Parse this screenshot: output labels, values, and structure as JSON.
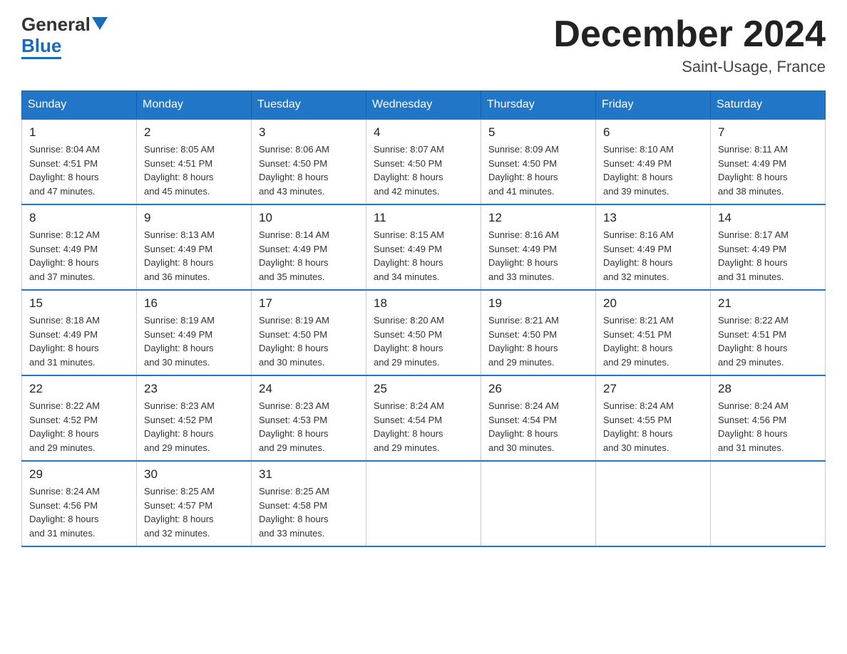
{
  "logo": {
    "text_general": "General",
    "text_blue": "Blue",
    "arrow_alt": "arrow"
  },
  "header": {
    "month_title": "December 2024",
    "location": "Saint-Usage, France"
  },
  "weekdays": [
    "Sunday",
    "Monday",
    "Tuesday",
    "Wednesday",
    "Thursday",
    "Friday",
    "Saturday"
  ],
  "weeks": [
    [
      {
        "day": "1",
        "sunrise": "8:04 AM",
        "sunset": "4:51 PM",
        "daylight": "8 hours and 47 minutes."
      },
      {
        "day": "2",
        "sunrise": "8:05 AM",
        "sunset": "4:51 PM",
        "daylight": "8 hours and 45 minutes."
      },
      {
        "day": "3",
        "sunrise": "8:06 AM",
        "sunset": "4:50 PM",
        "daylight": "8 hours and 43 minutes."
      },
      {
        "day": "4",
        "sunrise": "8:07 AM",
        "sunset": "4:50 PM",
        "daylight": "8 hours and 42 minutes."
      },
      {
        "day": "5",
        "sunrise": "8:09 AM",
        "sunset": "4:50 PM",
        "daylight": "8 hours and 41 minutes."
      },
      {
        "day": "6",
        "sunrise": "8:10 AM",
        "sunset": "4:49 PM",
        "daylight": "8 hours and 39 minutes."
      },
      {
        "day": "7",
        "sunrise": "8:11 AM",
        "sunset": "4:49 PM",
        "daylight": "8 hours and 38 minutes."
      }
    ],
    [
      {
        "day": "8",
        "sunrise": "8:12 AM",
        "sunset": "4:49 PM",
        "daylight": "8 hours and 37 minutes."
      },
      {
        "day": "9",
        "sunrise": "8:13 AM",
        "sunset": "4:49 PM",
        "daylight": "8 hours and 36 minutes."
      },
      {
        "day": "10",
        "sunrise": "8:14 AM",
        "sunset": "4:49 PM",
        "daylight": "8 hours and 35 minutes."
      },
      {
        "day": "11",
        "sunrise": "8:15 AM",
        "sunset": "4:49 PM",
        "daylight": "8 hours and 34 minutes."
      },
      {
        "day": "12",
        "sunrise": "8:16 AM",
        "sunset": "4:49 PM",
        "daylight": "8 hours and 33 minutes."
      },
      {
        "day": "13",
        "sunrise": "8:16 AM",
        "sunset": "4:49 PM",
        "daylight": "8 hours and 32 minutes."
      },
      {
        "day": "14",
        "sunrise": "8:17 AM",
        "sunset": "4:49 PM",
        "daylight": "8 hours and 31 minutes."
      }
    ],
    [
      {
        "day": "15",
        "sunrise": "8:18 AM",
        "sunset": "4:49 PM",
        "daylight": "8 hours and 31 minutes."
      },
      {
        "day": "16",
        "sunrise": "8:19 AM",
        "sunset": "4:49 PM",
        "daylight": "8 hours and 30 minutes."
      },
      {
        "day": "17",
        "sunrise": "8:19 AM",
        "sunset": "4:50 PM",
        "daylight": "8 hours and 30 minutes."
      },
      {
        "day": "18",
        "sunrise": "8:20 AM",
        "sunset": "4:50 PM",
        "daylight": "8 hours and 29 minutes."
      },
      {
        "day": "19",
        "sunrise": "8:21 AM",
        "sunset": "4:50 PM",
        "daylight": "8 hours and 29 minutes."
      },
      {
        "day": "20",
        "sunrise": "8:21 AM",
        "sunset": "4:51 PM",
        "daylight": "8 hours and 29 minutes."
      },
      {
        "day": "21",
        "sunrise": "8:22 AM",
        "sunset": "4:51 PM",
        "daylight": "8 hours and 29 minutes."
      }
    ],
    [
      {
        "day": "22",
        "sunrise": "8:22 AM",
        "sunset": "4:52 PM",
        "daylight": "8 hours and 29 minutes."
      },
      {
        "day": "23",
        "sunrise": "8:23 AM",
        "sunset": "4:52 PM",
        "daylight": "8 hours and 29 minutes."
      },
      {
        "day": "24",
        "sunrise": "8:23 AM",
        "sunset": "4:53 PM",
        "daylight": "8 hours and 29 minutes."
      },
      {
        "day": "25",
        "sunrise": "8:24 AM",
        "sunset": "4:54 PM",
        "daylight": "8 hours and 29 minutes."
      },
      {
        "day": "26",
        "sunrise": "8:24 AM",
        "sunset": "4:54 PM",
        "daylight": "8 hours and 30 minutes."
      },
      {
        "day": "27",
        "sunrise": "8:24 AM",
        "sunset": "4:55 PM",
        "daylight": "8 hours and 30 minutes."
      },
      {
        "day": "28",
        "sunrise": "8:24 AM",
        "sunset": "4:56 PM",
        "daylight": "8 hours and 31 minutes."
      }
    ],
    [
      {
        "day": "29",
        "sunrise": "8:24 AM",
        "sunset": "4:56 PM",
        "daylight": "8 hours and 31 minutes."
      },
      {
        "day": "30",
        "sunrise": "8:25 AM",
        "sunset": "4:57 PM",
        "daylight": "8 hours and 32 minutes."
      },
      {
        "day": "31",
        "sunrise": "8:25 AM",
        "sunset": "4:58 PM",
        "daylight": "8 hours and 33 minutes."
      },
      null,
      null,
      null,
      null
    ]
  ],
  "labels": {
    "sunrise": "Sunrise:",
    "sunset": "Sunset:",
    "daylight": "Daylight:"
  }
}
